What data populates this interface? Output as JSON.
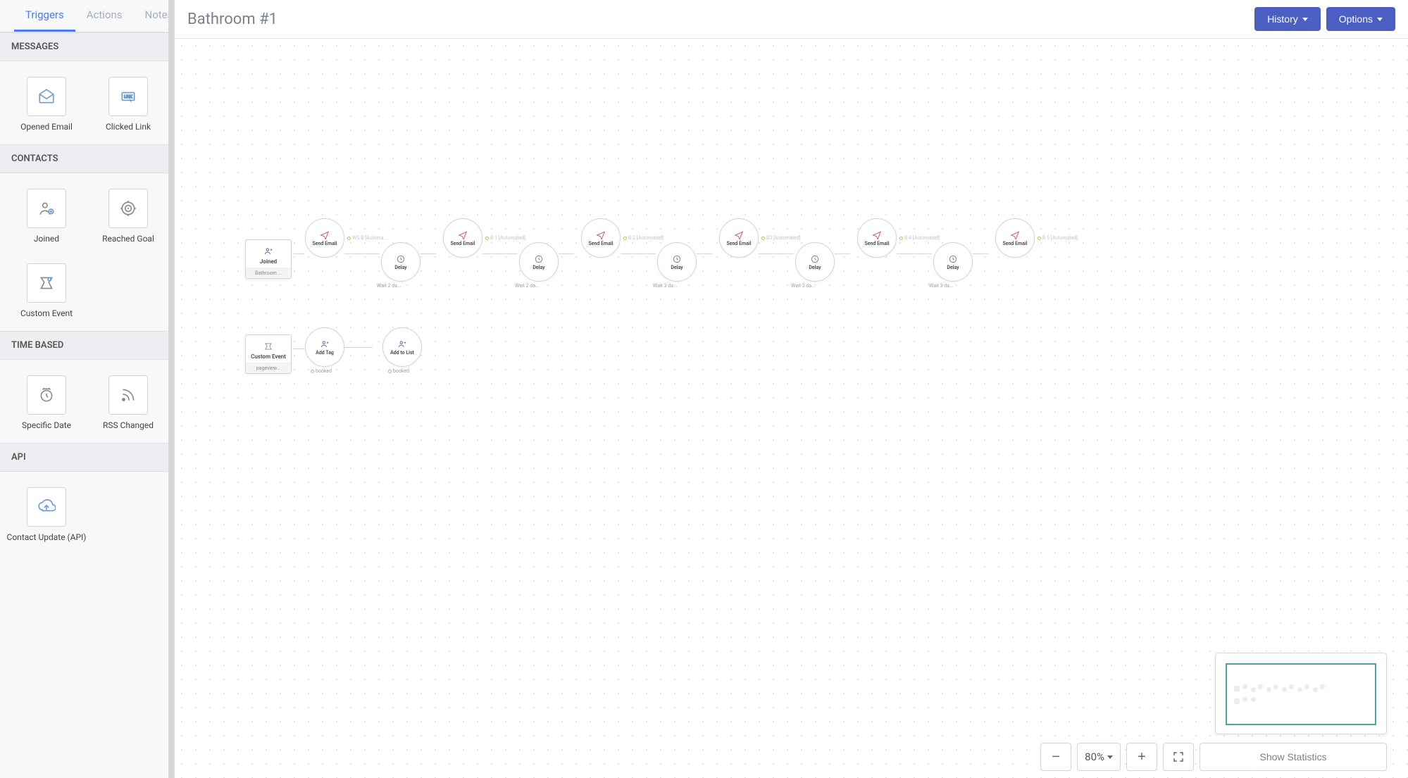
{
  "tabs": [
    {
      "label": "Triggers",
      "active": true
    },
    {
      "label": "Actions",
      "active": false
    },
    {
      "label": "Notes",
      "active": false
    }
  ],
  "header": {
    "title": "Bathroom #1",
    "history_label": "History",
    "options_label": "Options"
  },
  "sidebar": {
    "sections": [
      {
        "title": "MESSAGES",
        "items": [
          {
            "label": "Opened Email",
            "icon": "opened-email"
          },
          {
            "label": "Clicked Link",
            "icon": "clicked-link"
          }
        ]
      },
      {
        "title": "CONTACTS",
        "items": [
          {
            "label": "Joined",
            "icon": "joined"
          },
          {
            "label": "Reached Goal",
            "icon": "reached-goal"
          },
          {
            "label": "Custom Event",
            "icon": "custom-event"
          }
        ]
      },
      {
        "title": "TIME BASED",
        "items": [
          {
            "label": "Specific Date",
            "icon": "specific-date"
          },
          {
            "label": "RSS Changed",
            "icon": "rss-changed"
          }
        ]
      },
      {
        "title": "API",
        "items": [
          {
            "label": "Contact Update (API)",
            "icon": "contact-update"
          }
        ]
      }
    ]
  },
  "workflow": {
    "row1": {
      "trigger": {
        "title": "Joined",
        "sub": "Bathroom ..."
      },
      "emails": [
        {
          "title": "Send Email",
          "badge": "WS B [Automa..."
        },
        {
          "title": "Send Email",
          "badge": "B 1 [Automated]"
        },
        {
          "title": "Send Email",
          "badge": "B 2 [Automated]"
        },
        {
          "title": "Send Email",
          "badge": "B3 [Automated]"
        },
        {
          "title": "Send Email",
          "badge": "B 4 [Automated]"
        },
        {
          "title": "Send Email",
          "badge": "B 5 [Automated]"
        }
      ],
      "delays": [
        {
          "title": "Delay",
          "sub": "Wait  2 da..."
        },
        {
          "title": "Delay",
          "sub": "Wait  2 da..."
        },
        {
          "title": "Delay",
          "sub": "Wait  3 da..."
        },
        {
          "title": "Delay",
          "sub": "Wait  3 da..."
        },
        {
          "title": "Delay",
          "sub": "Wait  3 da..."
        }
      ]
    },
    "row2": {
      "trigger": {
        "title": "Custom Event",
        "sub": "pageview..."
      },
      "actions": [
        {
          "title": "Add Tag",
          "sub": "booked"
        },
        {
          "title": "Add to List",
          "sub": "booked"
        }
      ]
    }
  },
  "footer": {
    "zoom": "80%",
    "stats_label": "Show Statistics"
  }
}
